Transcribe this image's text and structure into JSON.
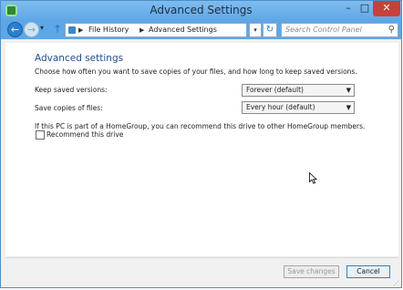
{
  "window": {
    "title": "Advanced Settings",
    "min_glyph": "–",
    "max_glyph": "□",
    "close_glyph": "✕"
  },
  "nav": {
    "back_glyph": "←",
    "forward_glyph": "→",
    "recent_glyph": "▾",
    "up_glyph": "↑",
    "breadcrumb_sep": "▶",
    "breadcrumb": [
      "File History",
      "Advanced Settings"
    ],
    "address_dropdown_glyph": "▾",
    "refresh_glyph": "↻",
    "search_placeholder": "Search Control Panel",
    "search_icon_glyph": "⚲"
  },
  "main": {
    "heading": "Advanced settings",
    "description": "Choose how often you want to save copies of your files, and how long to keep saved versions.",
    "keep_label": "Keep saved versions:",
    "keep_value": "Forever (default)",
    "save_label": "Save copies of files:",
    "save_value": "Every hour (default)",
    "homegroup_text": "If this PC is part of a HomeGroup, you can recommend this drive to other HomeGroup members.",
    "recommend_label": "Recommend this drive",
    "recommend_checked": false,
    "select_arrow": "▼"
  },
  "footer": {
    "save_label": "Save changes",
    "cancel_label": "Cancel"
  },
  "colors": {
    "accent": "#5ea6e6",
    "heading": "#1e4e8c",
    "close": "#c7413b"
  }
}
